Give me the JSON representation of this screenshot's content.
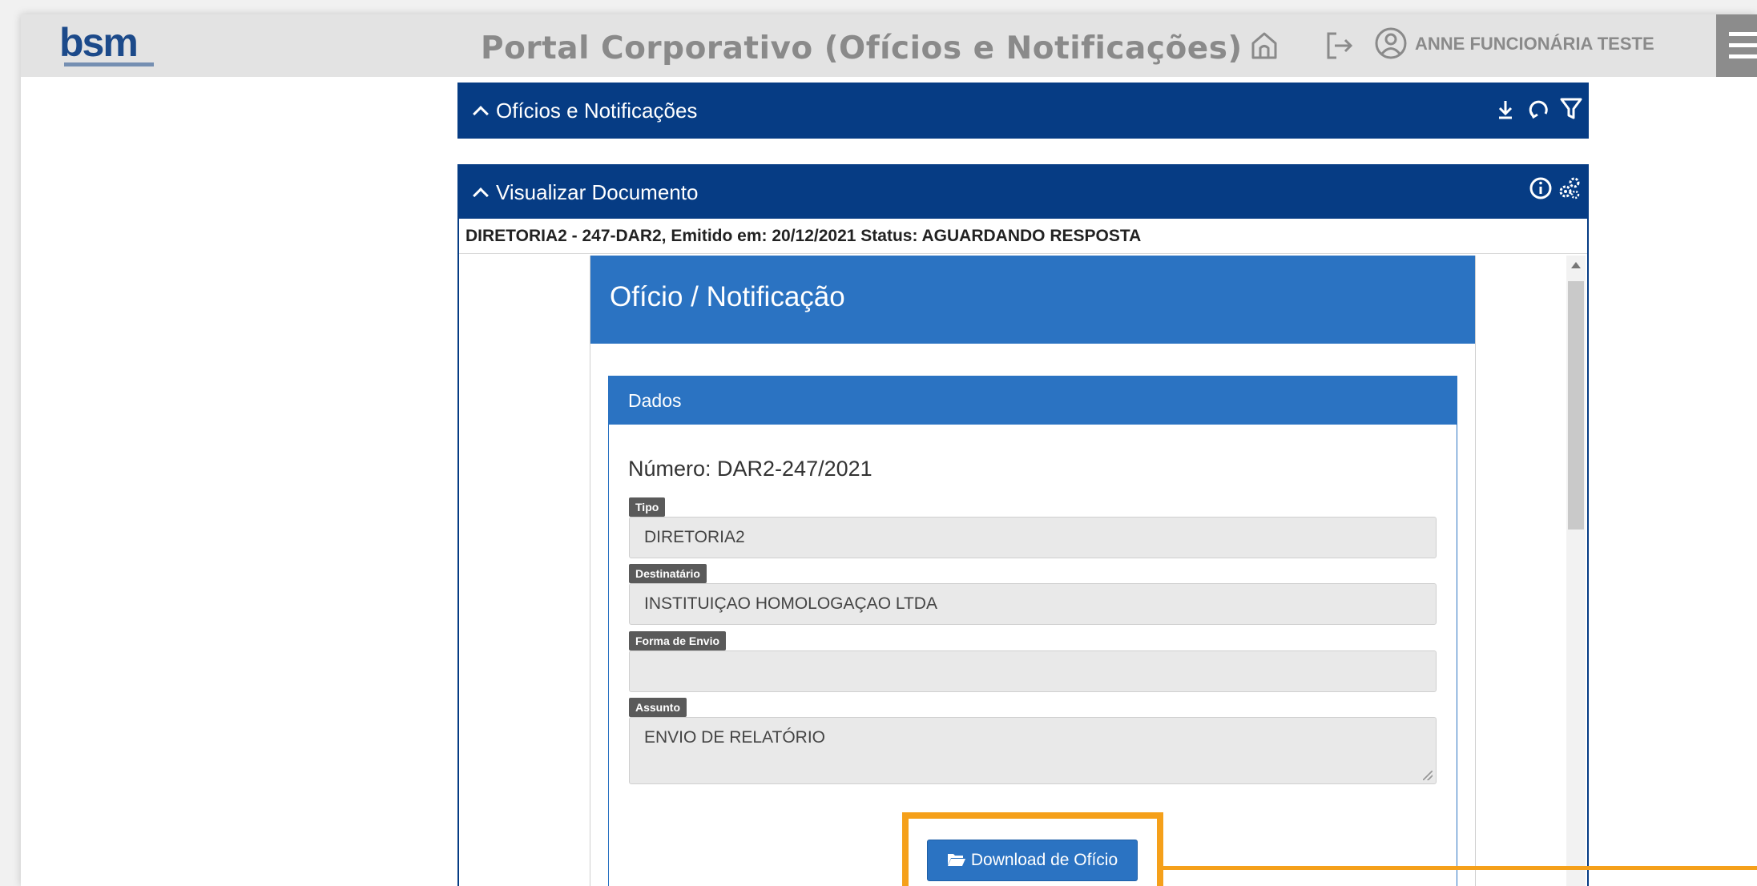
{
  "header": {
    "logo_text": "bsm",
    "app_title": "Portal Corporativo (Ofícios e Notificações)",
    "user_name": "ANNE FUNCIONÁRIA TESTE",
    "icons": [
      "home-icon",
      "logout-icon",
      "user-icon",
      "menu-icon"
    ]
  },
  "panels": {
    "oficios": {
      "title": "Ofícios e Notificações",
      "icons": [
        "download-icon",
        "refresh-icon",
        "filter-icon"
      ]
    },
    "visualizar": {
      "title": "Visualizar Documento",
      "icons": [
        "info-icon",
        "settings-icon"
      ]
    }
  },
  "document": {
    "meta": "DIRETORIA2 - 247-DAR2, Emitido em: 20/12/2021 Status: AGUARDANDO RESPOSTA",
    "card_title": "Ofício / Notificação",
    "section_title": "Dados",
    "numero": "Número: DAR2-247/2021",
    "fields": {
      "tipo": {
        "label": "Tipo",
        "value": "DIRETORIA2"
      },
      "destinatario": {
        "label": "Destinatário",
        "value": "INSTITUIÇAO HOMOLOGAÇAO LTDA"
      },
      "forma_envio": {
        "label": "Forma de Envio",
        "value": ""
      },
      "assunto": {
        "label": "Assunto",
        "value": "ENVIO DE RELATÓRIO"
      }
    },
    "download_label": "Download de Ofício"
  },
  "colors": {
    "navy": "#063c84",
    "blue": "#2b73c2",
    "highlight": "#f5a01a",
    "topbar": "#e3e3e3"
  }
}
